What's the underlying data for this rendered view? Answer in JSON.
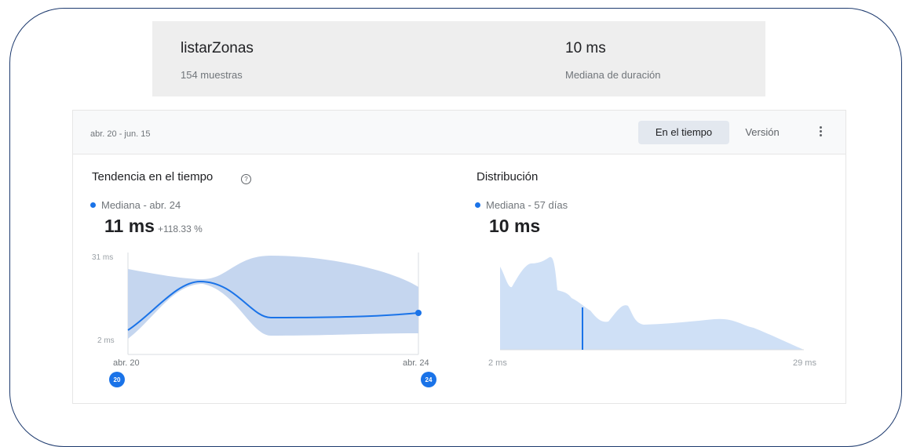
{
  "summary": {
    "title": "listarZonas",
    "samples": "154 muestras",
    "value": "10 ms",
    "value_label": "Mediana de duración"
  },
  "card": {
    "date_range": "abr. 20 - jun. 15",
    "tabs": [
      "En el tiempo",
      "Versión"
    ],
    "active_tab": "En el tiempo",
    "more_icon": "more-vert-icon"
  },
  "trend": {
    "title": "Tendencia en el tiempo",
    "help_icon": "help-icon",
    "legend": "Mediana - abr. 24",
    "value": "11 ms",
    "delta": "+118.33 %",
    "y_top_label": "31 ms",
    "y_bottom_label": "2 ms",
    "x_start_label": "abr. 20",
    "x_end_label": "abr. 24",
    "marker_start": "20",
    "marker_end": "24"
  },
  "distribution": {
    "title": "Distribución",
    "legend": "Mediana - 57 días",
    "value": "10 ms",
    "x_start_label": "2 ms",
    "x_end_label": "29 ms"
  },
  "colors": {
    "accent": "#1a73e8",
    "band": "#c5d6ef",
    "frame": "#1d3a6e"
  }
}
